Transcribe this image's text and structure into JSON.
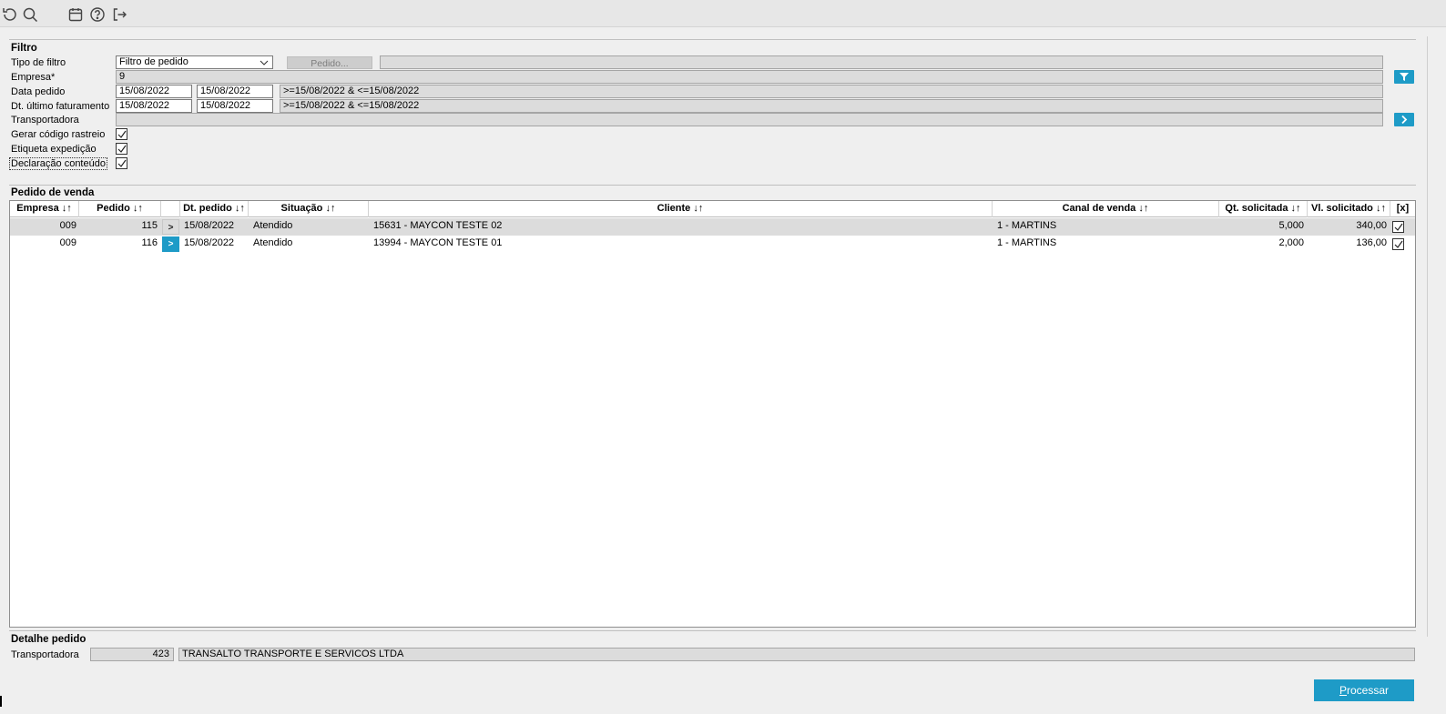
{
  "toolbar": {
    "icons": [
      "undo-icon",
      "search-icon",
      "calendar-icon",
      "help-icon",
      "logout-icon"
    ]
  },
  "filter": {
    "title": "Filtro",
    "tipo_filtro_label": "Tipo de filtro",
    "tipo_filtro_value": "Filtro de pedido",
    "pedido_button": "Pedido...",
    "empresa_label": "Empresa*",
    "empresa_value": "9",
    "data_pedido_label": "Data pedido",
    "data_pedido_from": "15/08/2022",
    "data_pedido_to": "15/08/2022",
    "data_pedido_expr": ">=15/08/2022 & <=15/08/2022",
    "dt_ult_fat_label": "Dt. último faturamento",
    "dt_ult_fat_from": "15/08/2022",
    "dt_ult_fat_to": "15/08/2022",
    "dt_ult_fat_expr": ">=15/08/2022 & <=15/08/2022",
    "transportadora_label": "Transportadora",
    "transportadora_value": "",
    "gerar_codigo_label": "Gerar código rastreio",
    "gerar_codigo_checked": true,
    "etiqueta_label": "Etiqueta expedição",
    "etiqueta_checked": true,
    "declaracao_label": "Declaração conteúdo",
    "declaracao_checked": true
  },
  "pedidos": {
    "title": "Pedido de venda",
    "columns": {
      "empresa": "Empresa ↓↑",
      "pedido": "Pedido ↓↑",
      "dt_pedido": "Dt. pedido ↓↑",
      "situacao": "Situação ↓↑",
      "cliente": "Cliente ↓↑",
      "canal": "Canal de venda ↓↑",
      "qt": "Qt. solicitada ↓↑",
      "vl": "Vl. solicitado ↓↑",
      "sel": "[x]"
    },
    "rows": [
      {
        "empresa": "009",
        "pedido": "115",
        "btn": ">",
        "dt_pedido": "15/08/2022",
        "situacao": "Atendido",
        "cliente": "15631 - MAYCON TESTE 02",
        "canal": "1 - MARTINS",
        "qt": "5,000",
        "vl": "340,00",
        "checked": true,
        "selected": true
      },
      {
        "empresa": "009",
        "pedido": "116",
        "btn": ">",
        "dt_pedido": "15/08/2022",
        "situacao": "Atendido",
        "cliente": "13994 - MAYCON TESTE 01",
        "canal": "1 - MARTINS",
        "qt": "2,000",
        "vl": "136,00",
        "checked": true,
        "selected": false
      }
    ]
  },
  "detalhe": {
    "title": "Detalhe pedido",
    "transportadora_label": "Transportadora",
    "transportadora_code": "423",
    "transportadora_name": "TRANSALTO TRANSPORTE E SERVICOS LTDA"
  },
  "actions": {
    "processar_first": "P",
    "processar_rest": "rocessar"
  },
  "colors": {
    "accent": "#1e9bc7",
    "readonly_bg": "#dcdcdc",
    "selected_row": "#dcdcdc"
  }
}
